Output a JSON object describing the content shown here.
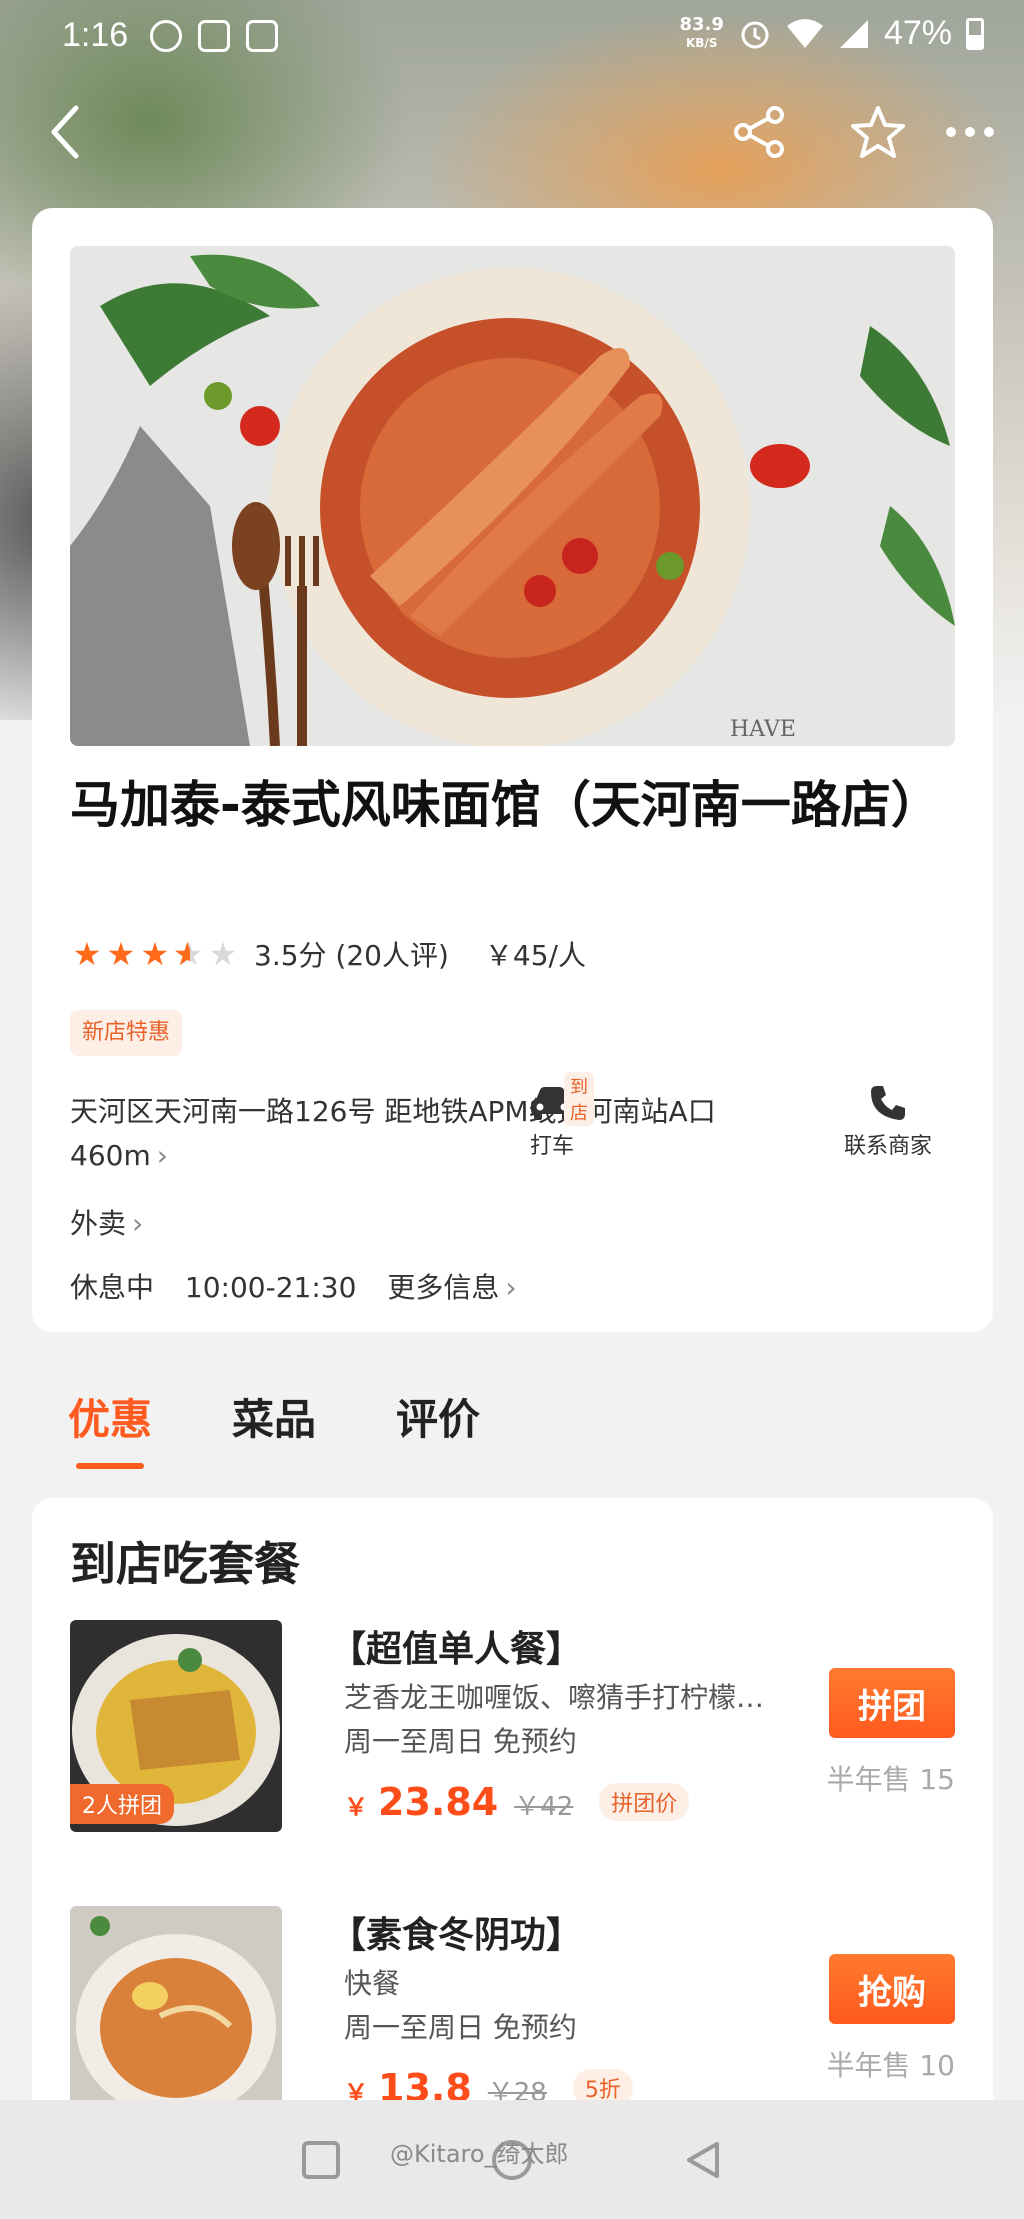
{
  "status_bar": {
    "time": "1:16",
    "net_speed": "83.9",
    "net_unit": "KB/S",
    "battery": "47%"
  },
  "store": {
    "name": "马加泰-泰式风味面馆（天河南一路店）",
    "rating_stars": 3.5,
    "rating_text": "3.5分 (20人评)",
    "per_person": "￥45/人",
    "promo_tag": "新店特惠",
    "address": "天河区天河南一路126号 距地铁APM线天河南站A口460m",
    "actions": {
      "taxi_tag": "到店",
      "taxi_label": "打车",
      "contact_label": "联系商家"
    },
    "takeout": "外卖",
    "status": "休息中",
    "hours": "10:00-21:30",
    "more_info": "更多信息"
  },
  "tabs": [
    "优惠",
    "菜品",
    "评价"
  ],
  "section": {
    "title": "到店吃套餐",
    "deals": [
      {
        "name": "【超值单人餐】",
        "desc": "芝香龙王咖喱饭、嚓猜手打柠檬…",
        "availability": "周一至周日  免预约",
        "currency": "￥",
        "price": "23.84",
        "orig_price": "￥42",
        "price_tag": "拼团价",
        "thumb_badge": "2人拼团",
        "button": "拼团",
        "sold": "半年售 15"
      },
      {
        "name": "【素食冬阴功】",
        "desc": "快餐",
        "availability": "周一至周日  免预约",
        "currency": "￥",
        "price": "13.8",
        "orig_price": "￥28",
        "price_tag": "5折",
        "thumb_badge": "",
        "button": "抢购",
        "sold": "半年售 10"
      }
    ]
  },
  "watermark": "@Kitaro_绮太郎",
  "colors": {
    "accent": "#ff5a1f",
    "tag_bg": "#fdeee6",
    "star": "#ff6a1a"
  }
}
